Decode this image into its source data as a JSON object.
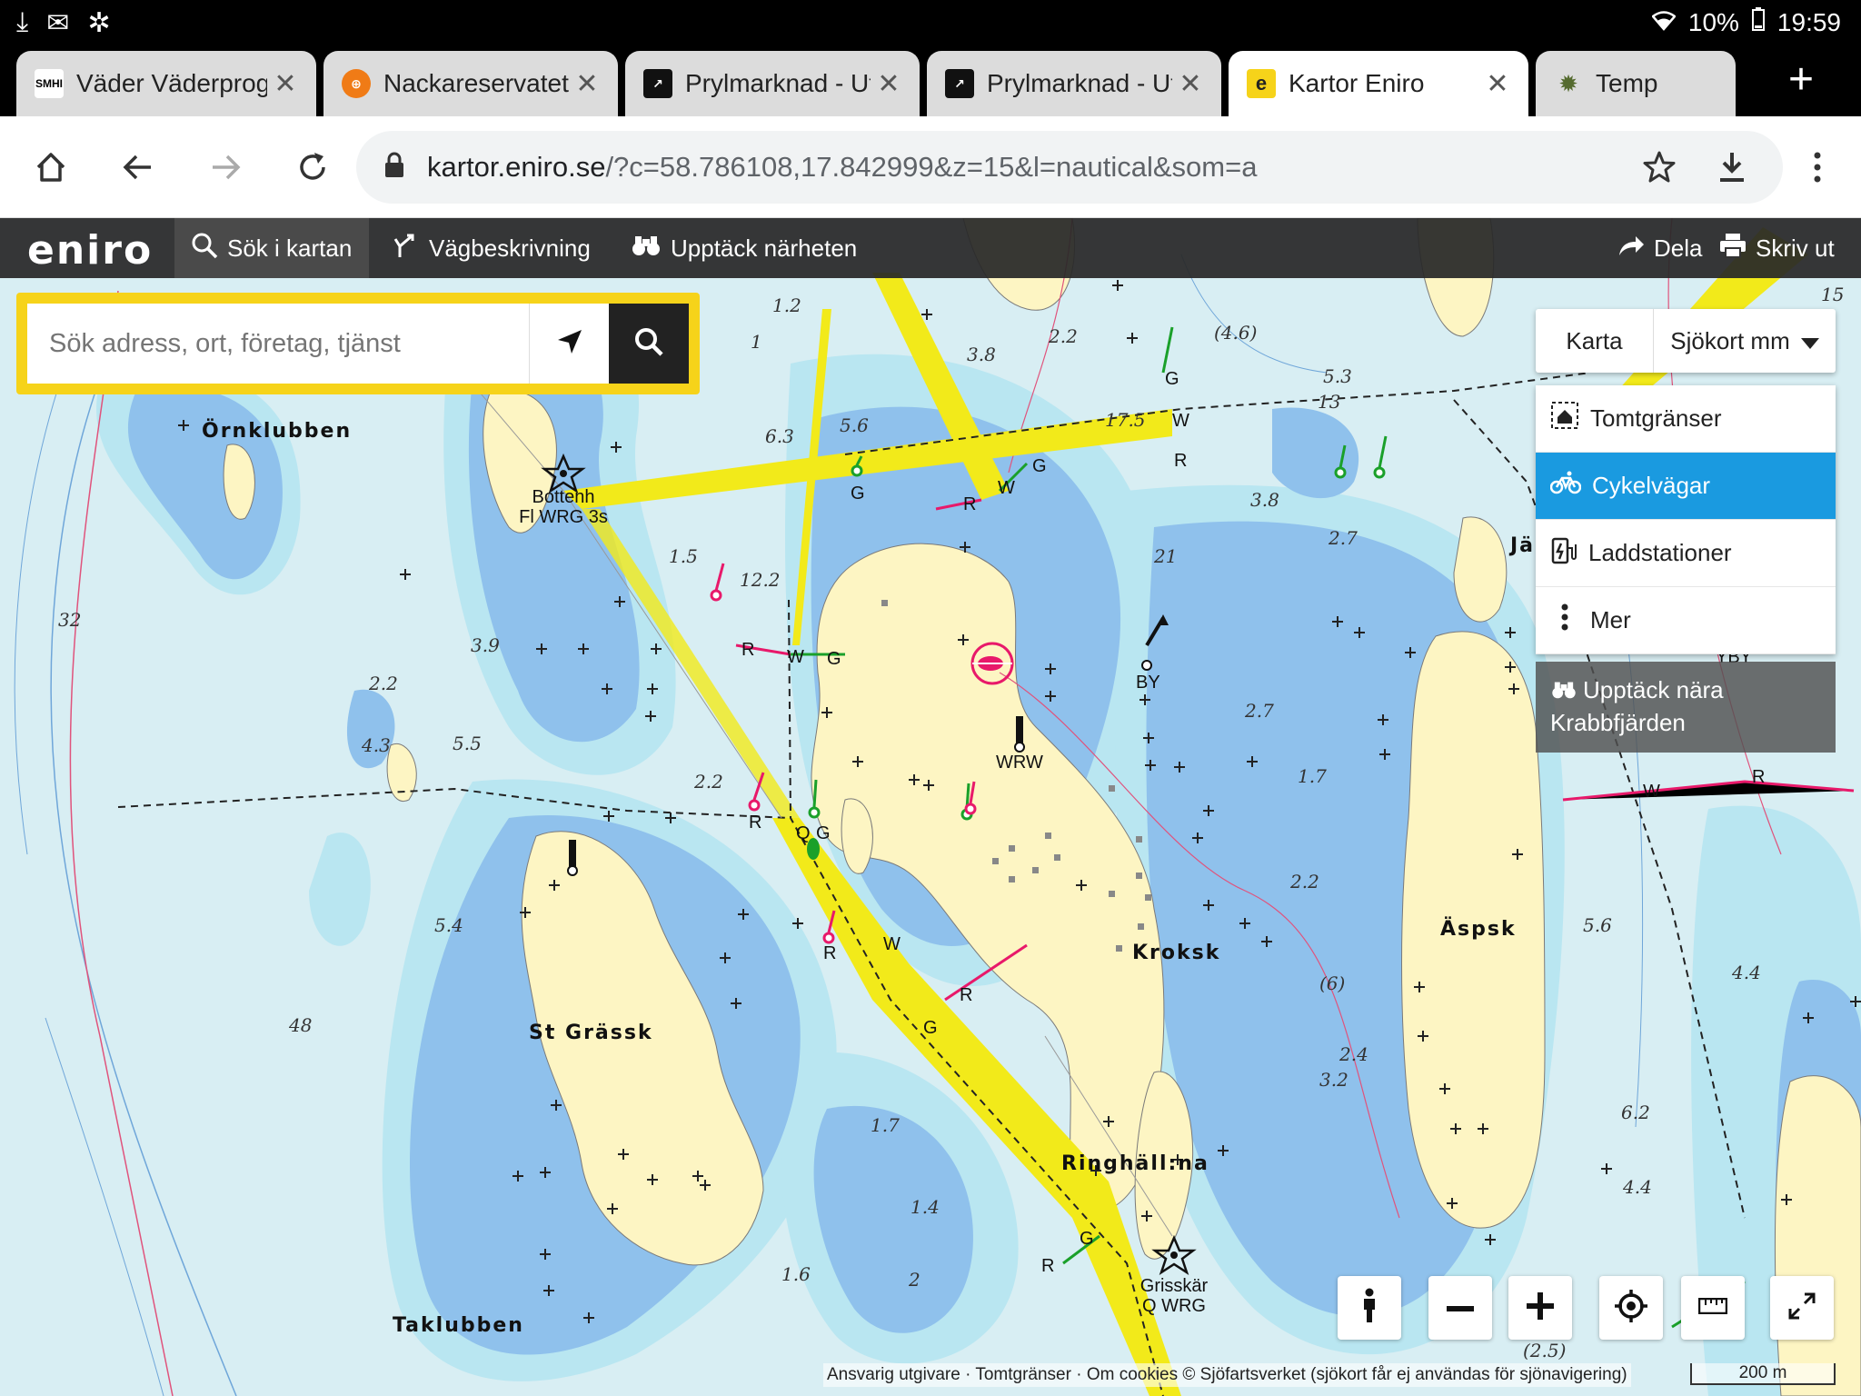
{
  "status_bar": {
    "battery": "10%",
    "time": "19:59",
    "icons": [
      "download-icon",
      "gmail-icon",
      "pinwheel-icon",
      "wifi-icon",
      "battery-icon"
    ]
  },
  "tabs": [
    {
      "title": "Väder Väderprog",
      "favicon_text": "SMHI",
      "favicon_color": "#ffffff",
      "active": false
    },
    {
      "title": "Nackareservatet",
      "favicon_text": "",
      "favicon_color": "#f07b16",
      "active": false
    },
    {
      "title": "Prylmarknad - Ut",
      "favicon_text": "",
      "favicon_color": "#111111",
      "active": false
    },
    {
      "title": "Prylmarknad - Ut",
      "favicon_text": "",
      "favicon_color": "#111111",
      "active": false
    },
    {
      "title": "Kartor Eniro",
      "favicon_text": "e",
      "favicon_color": "#f6d31a",
      "active": true
    },
    {
      "title": "Temp",
      "favicon_text": "",
      "favicon_color": "#556b2f",
      "active": false
    }
  ],
  "url": {
    "host": "kartor.eniro.se",
    "path": "/?c=58.786108,17.842999&z=15&l=nautical&som=a"
  },
  "eniro_nav": {
    "logo": "eniro",
    "search_map": "Sök i kartan",
    "directions": "Vägbeskrivning",
    "discover": "Upptäck närheten",
    "share": "Dela",
    "print": "Skriv ut"
  },
  "search": {
    "placeholder": "Sök adress, ort, företag, tjänst"
  },
  "layers": {
    "karta": "Karta",
    "selected": "Sjökort mm",
    "overlays": [
      {
        "label": "Tomtgränser",
        "icon": "house-boundary-icon",
        "selected": false
      },
      {
        "label": "Cykelvägar",
        "icon": "bicycle-icon",
        "selected": true
      },
      {
        "label": "Laddstationer",
        "icon": "charging-station-icon",
        "selected": false
      },
      {
        "label": "Mer",
        "icon": "more-vertical-icon",
        "selected": false
      }
    ],
    "discover_near": "Upptäck nära Krabbfjärden"
  },
  "attribution": "Ansvarig utgivare · Tomtgränser · Om cookies   © Sjöfartsverket (sjökort får ej användas för sjönavigering)",
  "scale": "200 m",
  "map_labels": {
    "places": [
      "Örnklubben",
      "St Grässk",
      "Kroksk",
      "Äspsk",
      "Ringhäll:na",
      "Taklubben",
      "Jä"
    ],
    "lights": [
      "Bottenh\nFl WRG 3s",
      "Grisskär\nQ WRG"
    ],
    "beacon": "WRW",
    "depths": [
      "1.2",
      "1",
      "3.8",
      "2.2",
      "(4.6)",
      "5.3",
      "6.3",
      "5.6",
      "17.5",
      "13",
      "12.2",
      "1.5",
      "3.9",
      "2.2",
      "4.3",
      "5.5",
      "2.2",
      "32",
      "3.8",
      "21",
      "2.7",
      "2.7",
      "1.7",
      "2.2",
      "5.4",
      "48",
      "1.7",
      "1.4",
      "1.6",
      "2",
      "2.4",
      "3.2",
      "6.2",
      "4.4",
      "5.6",
      "4.4",
      "(6)",
      "(2.5)",
      "15"
    ],
    "sector_letters": [
      "G",
      "W",
      "R",
      "G",
      "G",
      "W",
      "R",
      "W",
      "G",
      "R",
      "R",
      "Q",
      "G",
      "R",
      "W",
      "R",
      "G",
      "R",
      "G",
      "BY",
      "YBY",
      "W",
      "R"
    ]
  },
  "colors": {
    "land": "#fdf5c3",
    "shallow": "#8fc1ec",
    "medium": "#b9e6f1",
    "deep": "#d8eef3",
    "fairway": "#f2ea1a",
    "accent_blue": "#1a9ae0",
    "eniro_yellow": "#f6d31a"
  }
}
